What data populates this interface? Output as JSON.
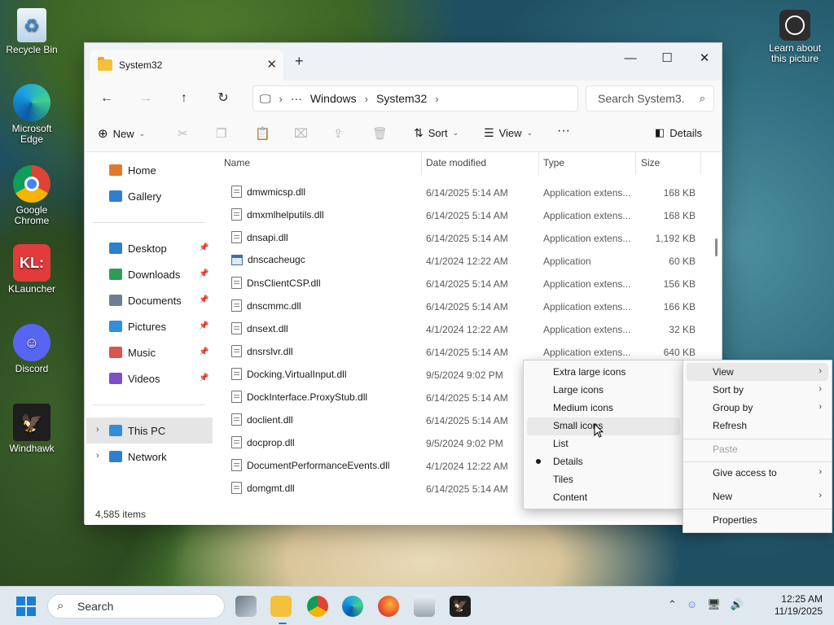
{
  "desktop": {
    "icons": [
      {
        "label": "Recycle Bin",
        "icon": "recycle-bin-icon"
      },
      {
        "label": "Microsoft Edge",
        "icon": "edge-icon"
      },
      {
        "label": "Google Chrome",
        "icon": "chrome-icon"
      },
      {
        "label": "KLauncher",
        "icon": "klauncher-icon",
        "glyph": "KL:"
      },
      {
        "label": "Discord",
        "icon": "discord-icon"
      },
      {
        "label": "Windhawk",
        "icon": "windhawk-icon"
      }
    ],
    "learn_label": "Learn about this picture"
  },
  "window": {
    "tab_title": "System32",
    "breadcrumb": [
      "Windows",
      "System32"
    ],
    "search_placeholder": "Search System3.",
    "commands": {
      "new": "New",
      "sort": "Sort",
      "view": "View",
      "details": "Details"
    },
    "nav": [
      {
        "label": "Home",
        "color": "#e07a2e"
      },
      {
        "label": "Gallery",
        "color": "#2f7fd0"
      },
      {
        "label": "Desktop",
        "color": "#2f7fd0"
      },
      {
        "label": "Downloads",
        "color": "#2b9d55"
      },
      {
        "label": "Documents",
        "color": "#6c7e92"
      },
      {
        "label": "Pictures",
        "color": "#2f8fd8"
      },
      {
        "label": "Music",
        "color": "#d9534f"
      },
      {
        "label": "Videos",
        "color": "#7a4fc9"
      },
      {
        "label": "This PC",
        "color": "#2f8fd8"
      },
      {
        "label": "Network",
        "color": "#2f7fd0"
      }
    ],
    "columns": [
      "Name",
      "Date modified",
      "Type",
      "Size"
    ],
    "files": [
      {
        "name": "dmwmicsp.dll",
        "date": "6/14/2025 5:14 AM",
        "type": "Application extens...",
        "size": "168 KB",
        "kind": "dll"
      },
      {
        "name": "dmxmlhelputils.dll",
        "date": "6/14/2025 5:14 AM",
        "type": "Application extens...",
        "size": "168 KB",
        "kind": "dll"
      },
      {
        "name": "dnsapi.dll",
        "date": "6/14/2025 5:14 AM",
        "type": "Application extens...",
        "size": "1,192 KB",
        "kind": "dll"
      },
      {
        "name": "dnscacheugc",
        "date": "4/1/2024 12:22 AM",
        "type": "Application",
        "size": "60 KB",
        "kind": "app"
      },
      {
        "name": "DnsClientCSP.dll",
        "date": "6/14/2025 5:14 AM",
        "type": "Application extens...",
        "size": "156 KB",
        "kind": "dll"
      },
      {
        "name": "dnscmmc.dll",
        "date": "6/14/2025 5:14 AM",
        "type": "Application extens...",
        "size": "166 KB",
        "kind": "dll"
      },
      {
        "name": "dnsext.dll",
        "date": "4/1/2024 12:22 AM",
        "type": "Application extens...",
        "size": "32 KB",
        "kind": "dll"
      },
      {
        "name": "dnsrslvr.dll",
        "date": "6/14/2025 5:14 AM",
        "type": "Application extens...",
        "size": "640 KB",
        "kind": "dll"
      },
      {
        "name": "Docking.VirtualInput.dll",
        "date": "9/5/2024 9:02 PM",
        "type": "",
        "size": "",
        "kind": "dll"
      },
      {
        "name": "DockInterface.ProxyStub.dll",
        "date": "6/14/2025 5:14 AM",
        "type": "",
        "size": "",
        "kind": "dll"
      },
      {
        "name": "doclient.dll",
        "date": "6/14/2025 5:14 AM",
        "type": "",
        "size": "",
        "kind": "dll"
      },
      {
        "name": "docprop.dll",
        "date": "9/5/2024 9:02 PM",
        "type": "",
        "size": "",
        "kind": "dll"
      },
      {
        "name": "DocumentPerformanceEvents.dll",
        "date": "4/1/2024 12:22 AM",
        "type": "",
        "size": "",
        "kind": "dll"
      },
      {
        "name": "domgmt.dll",
        "date": "6/14/2025 5:14 AM",
        "type": "",
        "size": "",
        "kind": "dll"
      }
    ],
    "status": "4,585 items"
  },
  "context_menu": {
    "items": [
      "View",
      "Sort by",
      "Group by",
      "Refresh",
      "Paste",
      "Give access to",
      "New",
      "Properties"
    ]
  },
  "view_submenu": {
    "items": [
      "Extra large icons",
      "Large icons",
      "Medium icons",
      "Small icons",
      "List",
      "Details",
      "Tiles",
      "Content"
    ],
    "selected": "Details",
    "hovered": "Small icons"
  },
  "taskbar": {
    "search_label": "Search",
    "time": "12:25 AM",
    "date": "11/19/2025"
  },
  "colors": {
    "accent": "#1a7fd4",
    "folder": "#f3c13a",
    "hover": "#e9e9e9",
    "selected_nav": "#e5e5e5"
  }
}
